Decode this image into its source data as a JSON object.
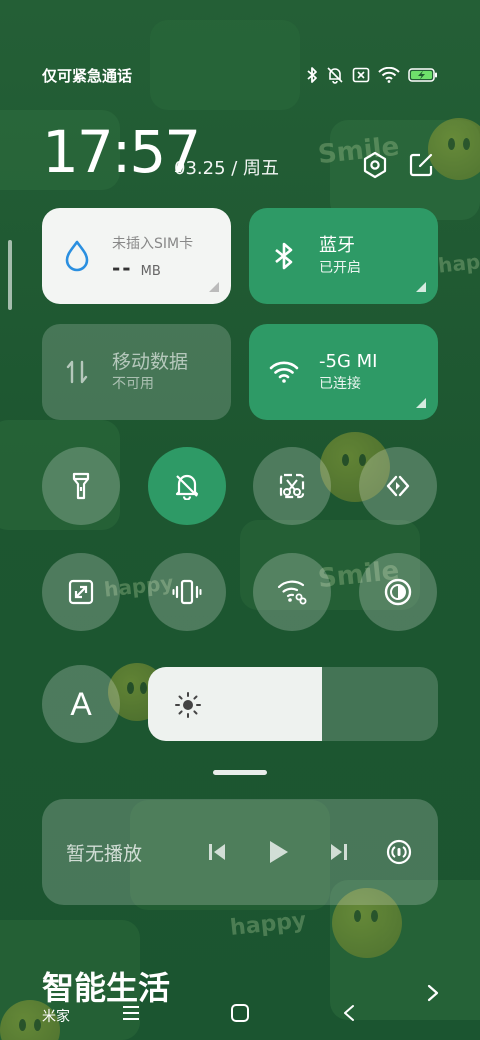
{
  "status_bar": {
    "carrier_text": "仅可紧急通话",
    "icons": [
      "bluetooth-icon",
      "mute-icon",
      "no-sim-icon",
      "wifi-icon",
      "battery-charging-icon"
    ]
  },
  "header": {
    "time": "17:57",
    "date": "03.25 / 周五",
    "settings_icon": "settings-hex-icon",
    "edit_icon": "edit-icon"
  },
  "tiles": {
    "sim": {
      "title": "未插入SIM卡",
      "usage": "--",
      "unit": "MB",
      "icon": "droplet-icon"
    },
    "bluetooth": {
      "title": "蓝牙",
      "status": "已开启",
      "icon": "bluetooth-icon"
    },
    "mobile_data": {
      "title": "移动数据",
      "status": "不可用",
      "icon": "data-arrows-icon"
    },
    "wifi": {
      "title": "-5G    MI",
      "status": "已连接",
      "icon": "wifi-icon"
    }
  },
  "toggles": [
    {
      "name": "flashlight-toggle",
      "icon": "flashlight-icon",
      "active": false
    },
    {
      "name": "mute-toggle",
      "icon": "bell-off-icon",
      "active": true
    },
    {
      "name": "screenshot-toggle",
      "icon": "scissors-icon",
      "active": false
    },
    {
      "name": "cast-toggle",
      "icon": "cast-icon",
      "active": false
    },
    {
      "name": "expand-toggle",
      "icon": "expand-icon",
      "active": false
    },
    {
      "name": "vibrate-toggle",
      "icon": "vibrate-icon",
      "active": false
    },
    {
      "name": "hotspot-toggle",
      "icon": "wifi-link-icon",
      "active": false
    },
    {
      "name": "dark-mode-toggle",
      "icon": "contrast-icon",
      "active": false
    }
  ],
  "brightness": {
    "font_button_label": "A",
    "level_percent": 60
  },
  "media": {
    "status": "暂无播放"
  },
  "smart_life": {
    "title": "智能生活",
    "subtitle": "米家"
  },
  "colors": {
    "accent": "#2e9a66",
    "wallpaper": "#1f5c33"
  }
}
